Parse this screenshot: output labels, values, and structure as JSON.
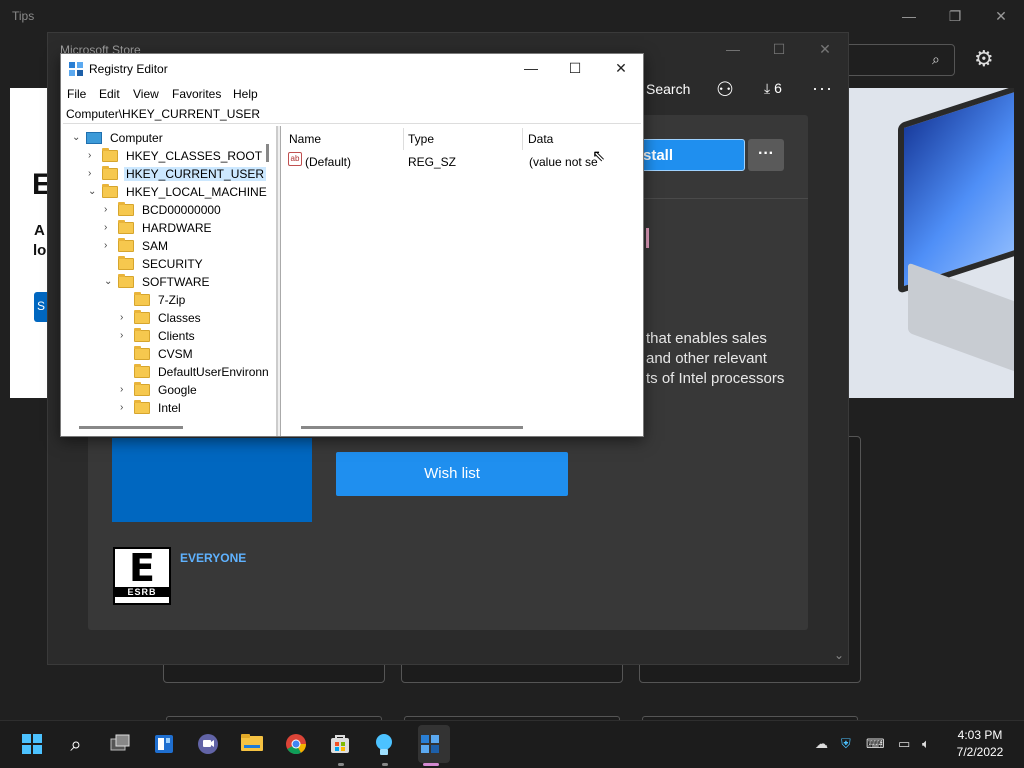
{
  "tips_window": {
    "title": "Tips",
    "heading_fragment": "E",
    "line1_fragment": "A",
    "line2_fragment": "lo",
    "button_fragment": "S",
    "caption": {
      "minimize": "—",
      "maximize": "❐",
      "close": "✕"
    }
  },
  "store_window": {
    "title": "Microsoft Store",
    "nav": {
      "search_label": "Search",
      "downloads_count": "6",
      "more": "···"
    },
    "install_label": "stall",
    "more_button": "···",
    "description_lines": [
      "that enables sales",
      "and other relevant",
      "ts of Intel processors"
    ],
    "wish_list_label": "Wish list",
    "esrb": {
      "rating_letter": "E",
      "rating_org": "ESRB",
      "rating_text": "EVERYONE"
    },
    "caption": {
      "minimize": "—",
      "maximize": "☐",
      "close": "✕"
    }
  },
  "registry_editor": {
    "title": "Registry Editor",
    "caption": {
      "minimize": "—",
      "maximize": "☐",
      "close": "✕"
    },
    "menu": [
      "File",
      "Edit",
      "View",
      "Favorites",
      "Help"
    ],
    "address": "Computer\\HKEY_CURRENT_USER",
    "tree": [
      {
        "label": "Computer",
        "expander": "⌄",
        "selected": false
      },
      {
        "label": "HKEY_CLASSES_ROOT",
        "expander": "›",
        "selected": false
      },
      {
        "label": "HKEY_CURRENT_USER",
        "expander": "›",
        "selected": true
      },
      {
        "label": "HKEY_LOCAL_MACHINE",
        "expander": "⌄",
        "selected": false
      },
      {
        "label": "BCD00000000",
        "expander": "›",
        "selected": false
      },
      {
        "label": "HARDWARE",
        "expander": "›",
        "selected": false
      },
      {
        "label": "SAM",
        "expander": "›",
        "selected": false
      },
      {
        "label": "SECURITY",
        "expander": "",
        "selected": false
      },
      {
        "label": "SOFTWARE",
        "expander": "⌄",
        "selected": false
      },
      {
        "label": "7-Zip",
        "expander": "",
        "selected": false
      },
      {
        "label": "Classes",
        "expander": "›",
        "selected": false
      },
      {
        "label": "Clients",
        "expander": "›",
        "selected": false
      },
      {
        "label": "CVSM",
        "expander": "",
        "selected": false
      },
      {
        "label": "DefaultUserEnvironn",
        "expander": "",
        "selected": false
      },
      {
        "label": "Google",
        "expander": "›",
        "selected": false
      },
      {
        "label": "Intel",
        "expander": "›",
        "selected": false
      }
    ],
    "columns": [
      "Name",
      "Type",
      "Data"
    ],
    "values": [
      {
        "icon": "ab",
        "name": "(Default)",
        "type": "REG_SZ",
        "data": "(value not se"
      }
    ]
  },
  "taskbar": {
    "icons": [
      "windows-start-icon",
      "search-icon",
      "task-view-icon",
      "widgets-icon",
      "teams-chat-icon",
      "file-explorer-icon",
      "chrome-icon",
      "microsoft-store-icon",
      "tips-icon",
      "registry-editor-icon"
    ],
    "time": "4:03 PM",
    "date": "7/2/2022"
  },
  "colors": {
    "accent_blue": "#1f8fef",
    "selection": "#cce8ff",
    "store_bg": "#2b2b2b",
    "esrb_text": "#5fb2ff"
  }
}
